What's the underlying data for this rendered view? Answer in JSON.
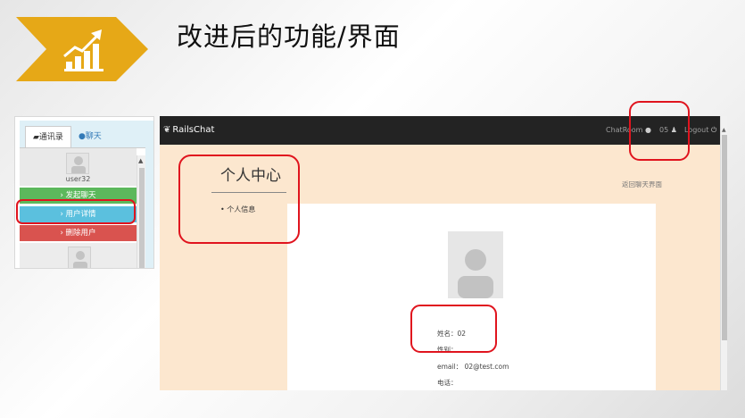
{
  "slide": {
    "title": "改进后的功能/界面",
    "accent_color": "#e6a817",
    "highlight_color": "#e0141e"
  },
  "left_panel": {
    "tabs": [
      {
        "label": "通讯录",
        "icon": "book-icon",
        "active": true
      },
      {
        "label": "聊天",
        "icon": "chat-bubbles-icon",
        "active": false
      }
    ],
    "username": "user32",
    "actions": {
      "start_chat": "› 发起聊天",
      "user_details": "› 用户详情",
      "delete_user": "› 删除用户"
    }
  },
  "app": {
    "brand": "RailsChat",
    "nav": {
      "chatroom": "ChatRoom",
      "user": "05",
      "logout": "Logout"
    },
    "sidebar_heading": "个人中心",
    "sidebar_item": "个人信息",
    "back_link": "返回聊天界面",
    "profile": {
      "name": "姓名：02",
      "gender": "性别：",
      "email": "email： 02@test.com",
      "phone": "电话："
    }
  }
}
